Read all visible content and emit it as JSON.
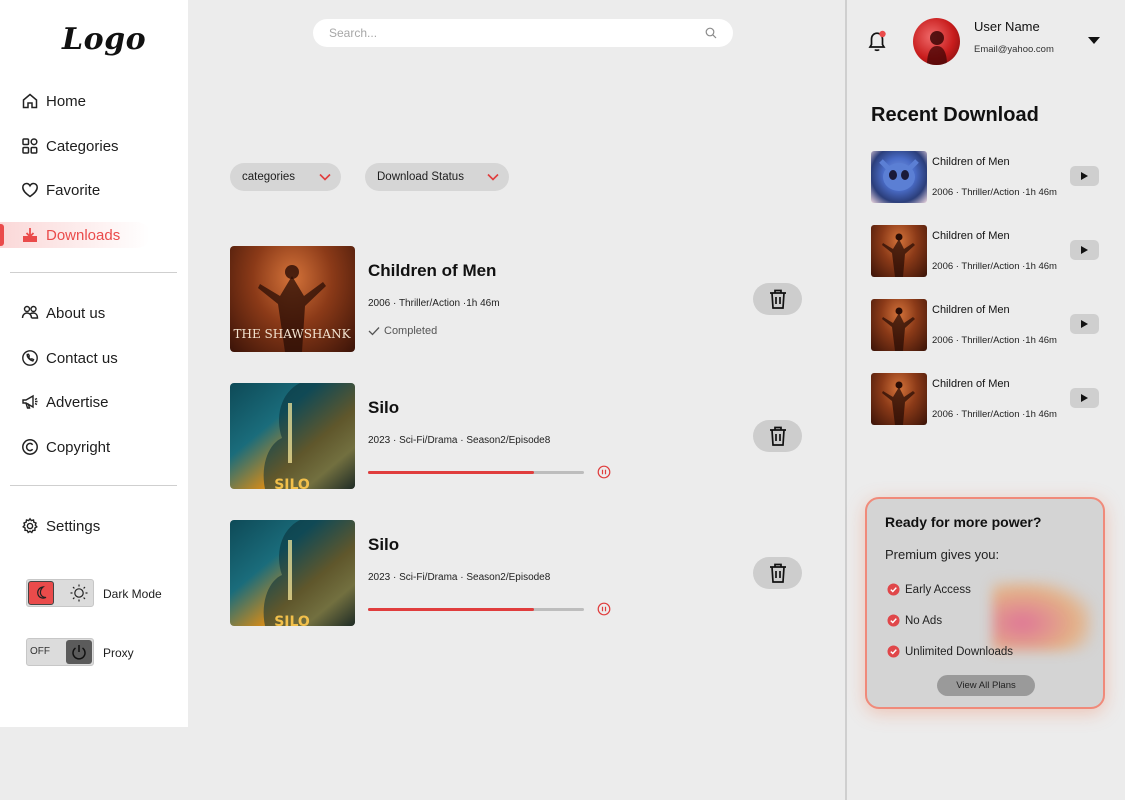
{
  "sidebar": {
    "logo": "Logo",
    "nav": [
      {
        "label": "Home",
        "icon": "home-icon"
      },
      {
        "label": "Categories",
        "icon": "categories-icon"
      },
      {
        "label": "Favorite",
        "icon": "heart-icon"
      },
      {
        "label": "Downloads",
        "icon": "download-icon",
        "active": true
      }
    ],
    "nav2": [
      {
        "label": "About us",
        "icon": "people-icon"
      },
      {
        "label": "Contact us",
        "icon": "phone-icon"
      },
      {
        "label": "Advertise",
        "icon": "megaphone-icon"
      },
      {
        "label": "Copyright",
        "icon": "copyright-icon"
      }
    ],
    "settings_label": "Settings",
    "dark_mode_label": "Dark Mode",
    "proxy_label": "Proxy",
    "proxy_state": "OFF"
  },
  "search": {
    "placeholder": "Search..."
  },
  "filters": {
    "categories": "categories",
    "download_status": "Download Status"
  },
  "downloads": [
    {
      "title": "Children of Men",
      "meta": "2006 · Thriller/Action ·1h 46m",
      "status": "Completed",
      "poster_text": "THE SHAWSHANK"
    },
    {
      "title": "Silo",
      "meta": "2023 · Sci-Fi/Drama · Season2/Episode8",
      "progress": 0.77,
      "poster_text": "SILO"
    },
    {
      "title": "Silo",
      "meta": "2023 · Sci-Fi/Drama · Season2/Episode8",
      "progress": 0.77,
      "poster_text": "SILO"
    }
  ],
  "user": {
    "name": "User Name",
    "email": "Email@yahoo.com"
  },
  "recent": {
    "title": "Recent Download",
    "items": [
      {
        "title": "Children of Men",
        "meta": "2006 · Thriller/Action ·1h 46m"
      },
      {
        "title": "Children of Men",
        "meta": "2006 · Thriller/Action ·1h 46m"
      },
      {
        "title": "Children of Men",
        "meta": "2006 · Thriller/Action ·1h 46m"
      },
      {
        "title": "Children of Men",
        "meta": "2006 · Thriller/Action ·1h 46m"
      }
    ]
  },
  "promo": {
    "title": "Ready for more power?",
    "subtitle": "Premium gives you:",
    "features": [
      "Early Access",
      "No Ads",
      "Unlimited Downloads"
    ],
    "button": "View All Plans"
  },
  "colors": {
    "accent": "#ea4b4b",
    "background": "#ececec",
    "promo_border": "#f08a7a"
  }
}
